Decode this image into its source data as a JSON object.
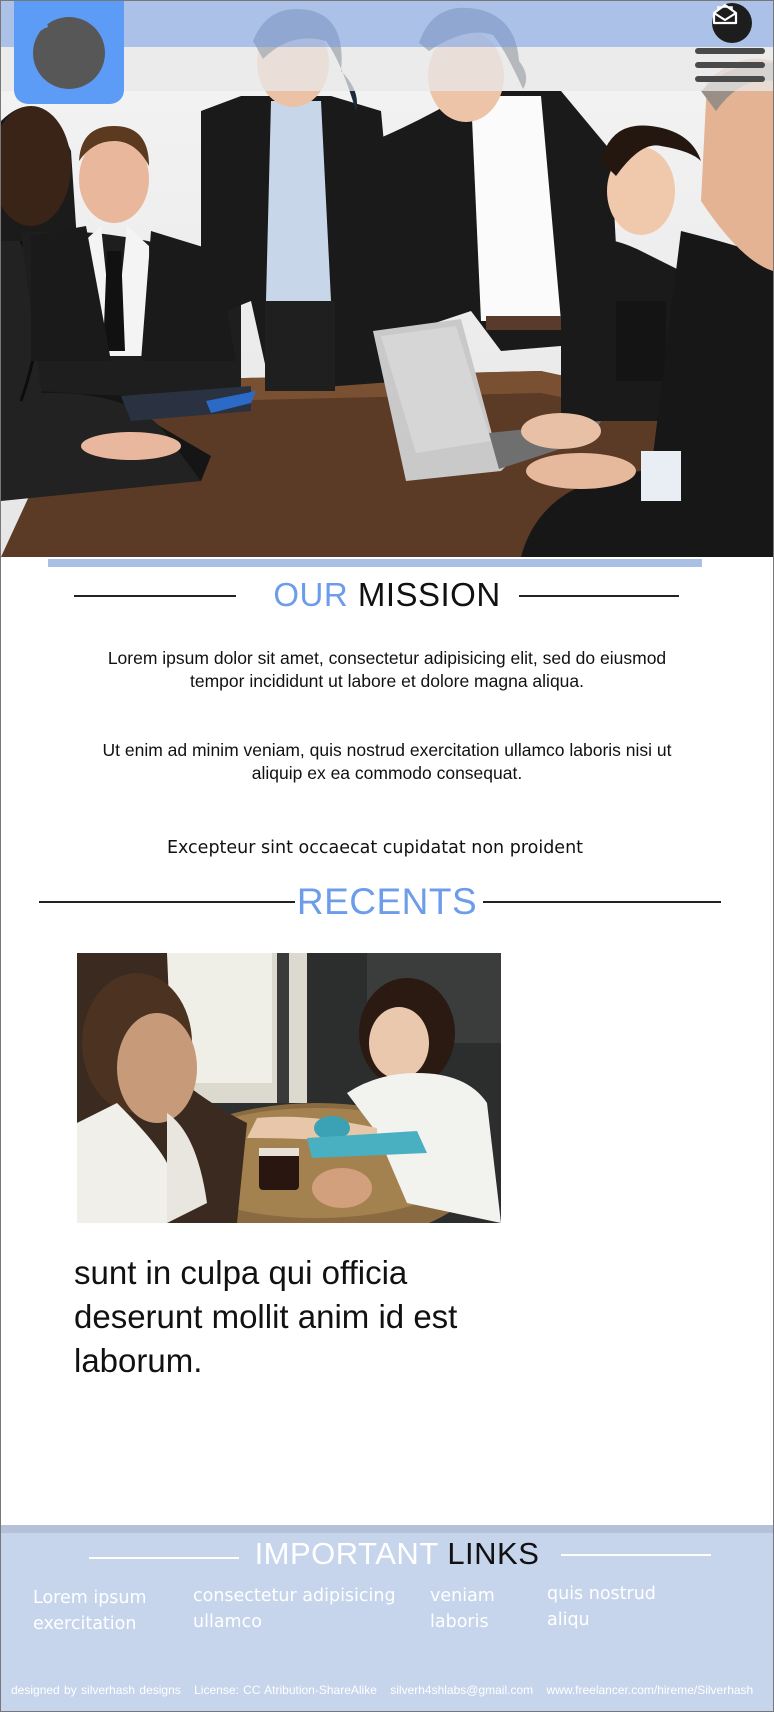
{
  "mission": {
    "title_accent": "OUR",
    "title_rest": " MISSION",
    "paragraph_1": "Lorem ipsum dolor sit amet, consectetur adipisicing elit, sed do eiusmod tempor incididunt ut labore et dolore magna aliqua.",
    "paragraph_2": "Ut enim ad minim veniam, quis nostrud exercitation ullamco laboris nisi ut aliquip ex ea commodo consequat.",
    "paragraph_3": "Excepteur sint occaecat cupidatat non proident"
  },
  "recents": {
    "title": "RECENTS",
    "post_text": "sunt in culpa qui officia deserunt mollit anim id est laborum."
  },
  "footer": {
    "title_accent": "IMPORTANT",
    "title_rest": " LINKS",
    "links": [
      {
        "line1": "Lorem ipsum",
        "line2": "exercitation"
      },
      {
        "line1": "consectetur adipisicing",
        "line2": "ullamco"
      },
      {
        "line1": "veniam",
        "line2": "laboris"
      },
      {
        "line1": "quis nostrud",
        "line2": "aliqu"
      }
    ],
    "credits": [
      "designed by silverhash designs",
      "License: CC Atribution-ShareAlike",
      "silverh4shlabs@gmail.com",
      "www.freelancer.com/hireme/Silverhash"
    ]
  },
  "icons": {
    "logo": "people-group-icon",
    "mail": "envelope-open-icon",
    "menu": "hamburger-menu-icon"
  },
  "colors": {
    "accent": "#6d9ceb",
    "logo_tile": "#5d9cf6",
    "footer_bg": "#c6d4ec",
    "top_band": "#a0b9e6"
  }
}
